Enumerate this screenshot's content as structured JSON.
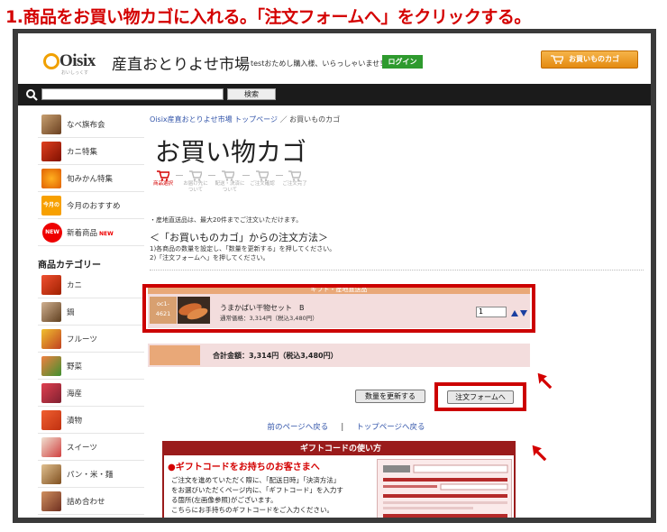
{
  "caption": "1.商品をお買い物カゴに入れる。「注文フォームへ」をクリックする。",
  "header": {
    "logo_text": "Oisix",
    "logo_sub": "おいしっくす",
    "site_title": "産直おとりよせ市場",
    "greeting": "testおためし購入様、いらっしゃいませ！",
    "login_label": "ログイン",
    "cart_label": "お買いものカゴ"
  },
  "search": {
    "placeholder": "",
    "button_label": "検索"
  },
  "sidebar": {
    "items": [
      {
        "label": "なべ旗布会"
      },
      {
        "label": "カニ特集"
      },
      {
        "label": "旬みかん特集"
      },
      {
        "label": "今月のおすすめ",
        "thumb_text": "今月の"
      },
      {
        "label": "新着商品",
        "badge": "NEW",
        "tag": "NEW"
      }
    ],
    "category_heading": "商品カテゴリー",
    "categories": [
      {
        "label": "カニ"
      },
      {
        "label": "鍋"
      },
      {
        "label": "フルーツ"
      },
      {
        "label": "野菜"
      },
      {
        "label": "海産"
      },
      {
        "label": "漬物"
      },
      {
        "label": "スイーツ"
      },
      {
        "label": "パン・米・麺"
      },
      {
        "label": "詰め合わせ"
      }
    ]
  },
  "breadcrumb": {
    "home": "Oisix産直おとりよせ市場 トップページ",
    "sep": "／",
    "current": "お買いものカゴ"
  },
  "page_title": "お買い物カゴ",
  "steps": [
    {
      "label": "商品選択"
    },
    {
      "label": "お届け先について"
    },
    {
      "label": "配送・決済について"
    },
    {
      "label": "ご注文確認"
    },
    {
      "label": "ご注文完了"
    }
  ],
  "note": "・産地直送品は、最大20件までご注文いただけます。",
  "howto": {
    "title": "＜「お買いものカゴ」からの注文方法＞",
    "line1": "1)各商品の数量を設定し、「数量を更新する」を押してください。",
    "line2": "2)「注文フォームへ」を押してください。"
  },
  "section_header": "ギフト・産地直送品",
  "item": {
    "code_line1": "oc1-",
    "code_line2": "4621",
    "name": "うまかばい干物セット　B",
    "price": "通常価格：3,314円（税込3,480円）",
    "quantity": "1"
  },
  "total": "合計金額：3,314円（税込3,480円）",
  "buttons": {
    "update": "数量を更新する",
    "order": "注文フォームへ"
  },
  "nav": {
    "back": "前のページへ戻る",
    "sep": "|",
    "top": "トップページへ戻る"
  },
  "gift": {
    "header": "ギフトコードの使い方",
    "subtitle": "●ギフトコードをお持ちのお客さまへ",
    "line1": "ご注文を進めていただく際に、「配送日時」「決済方法」",
    "line2": "をお選びいただくページ内に、「ギフトコード」を入力す",
    "line3": "る箇所(左画像参照)がございます。",
    "line4": "こちらにお手持ちのギフトコードをご入力ください。"
  },
  "colors": {
    "caption": "#d40000",
    "highlight": "#cc0000",
    "cart_button": "#e48a10",
    "login_button": "#2e9a2e",
    "section": "#e9a878",
    "row_bg": "#f3dddd",
    "gift": "#9a1b1b"
  }
}
